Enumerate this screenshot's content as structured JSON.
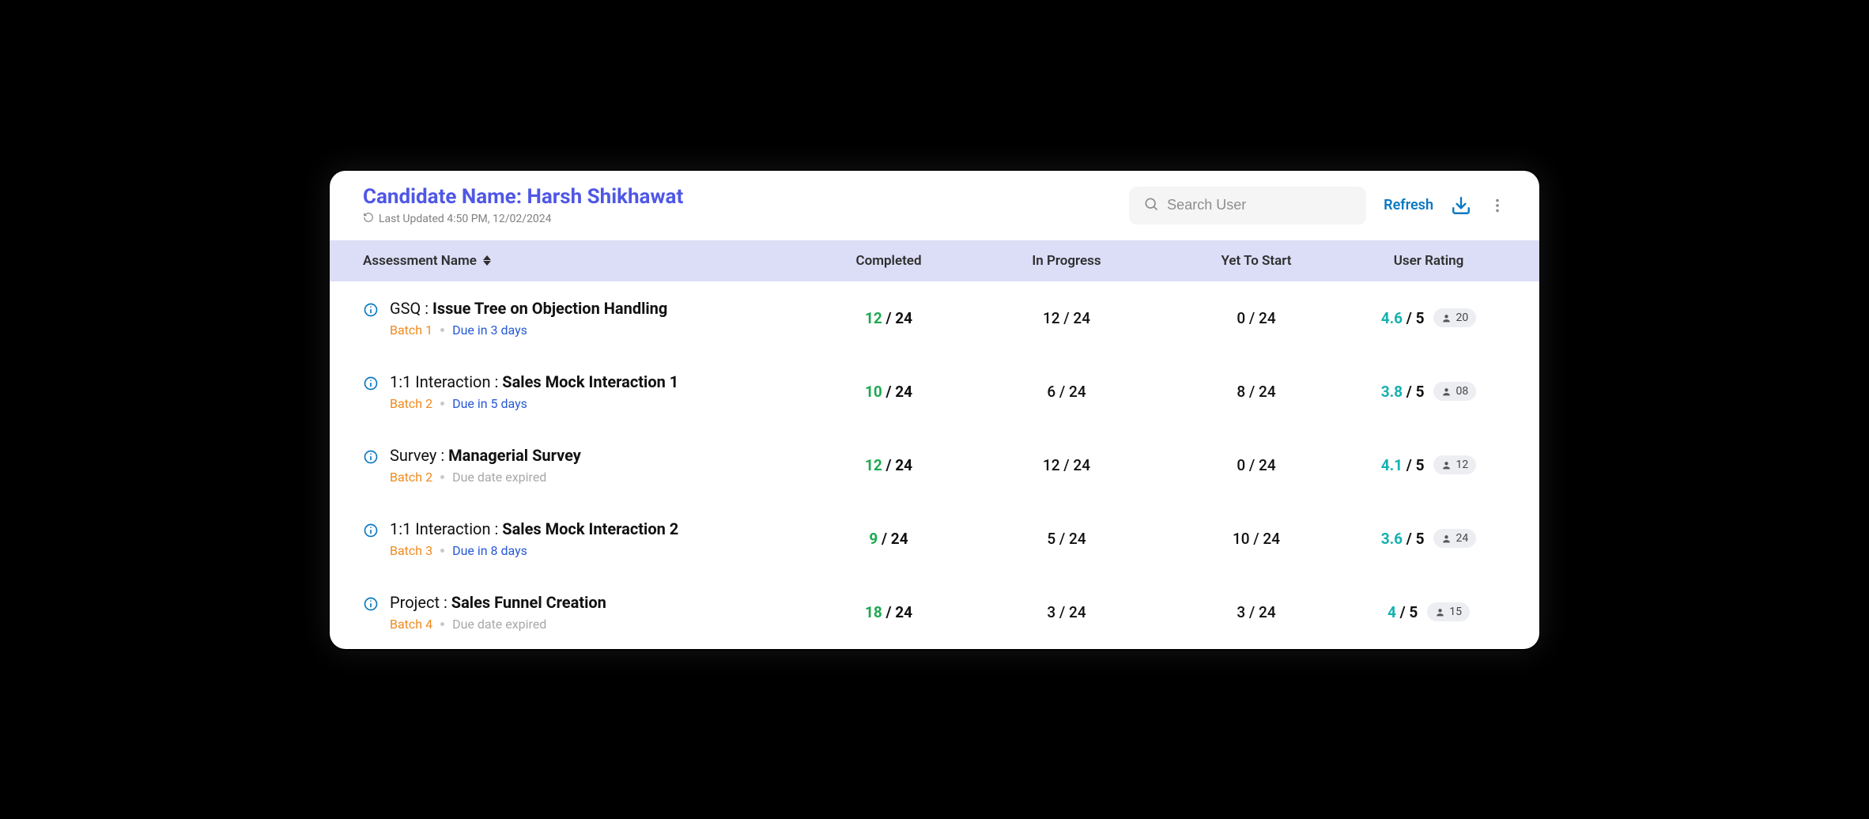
{
  "header": {
    "candidate_label": "Candidate Name: Harsh Shikhawat",
    "last_updated": "Last Updated 4:50 PM, 12/02/2024",
    "search_placeholder": "Search User",
    "refresh_label": "Refresh"
  },
  "columns": {
    "name": "Assessment Name",
    "completed": "Completed",
    "in_progress": "In Progress",
    "yet_to_start": "Yet To Start",
    "rating": "User Rating"
  },
  "rows": [
    {
      "prefix": "GSQ : ",
      "title": "Issue Tree on Objection Handling",
      "batch": "Batch 1",
      "due": "Due in 3 days",
      "due_expired": false,
      "completed_n": "12",
      "completed_d": " / 24",
      "in_progress": "12 / 24",
      "yet": "0 / 24",
      "rating_n": "4.6",
      "rating_d": " / 5",
      "count": "20"
    },
    {
      "prefix": "1:1 Interaction : ",
      "title": "Sales Mock Interaction 1",
      "batch": "Batch 2",
      "due": "Due in 5 days",
      "due_expired": false,
      "completed_n": "10",
      "completed_d": " / 24",
      "in_progress": "6 / 24",
      "yet": "8 / 24",
      "rating_n": "3.8",
      "rating_d": " / 5",
      "count": "08"
    },
    {
      "prefix": "Survey : ",
      "title": "Managerial Survey",
      "batch": "Batch 2",
      "due": "Due date expired",
      "due_expired": true,
      "completed_n": "12",
      "completed_d": " / 24",
      "in_progress": "12 / 24",
      "yet": "0 / 24",
      "rating_n": "4.1",
      "rating_d": " / 5",
      "count": "12"
    },
    {
      "prefix": "1:1 Interaction : ",
      "title": "Sales Mock Interaction 2",
      "batch": "Batch 3",
      "due": "Due in 8 days",
      "due_expired": false,
      "completed_n": "9",
      "completed_d": " / 24",
      "in_progress": "5 / 24",
      "yet": "10 / 24",
      "rating_n": "3.6",
      "rating_d": " / 5",
      "count": "24"
    },
    {
      "prefix": "Project : ",
      "title": "Sales Funnel Creation",
      "batch": "Batch 4",
      "due": "Due date expired",
      "due_expired": true,
      "completed_n": "18",
      "completed_d": " / 24",
      "in_progress": "3 / 24",
      "yet": "3 / 24",
      "rating_n": "4",
      "rating_d": " / 5",
      "count": "15"
    }
  ]
}
